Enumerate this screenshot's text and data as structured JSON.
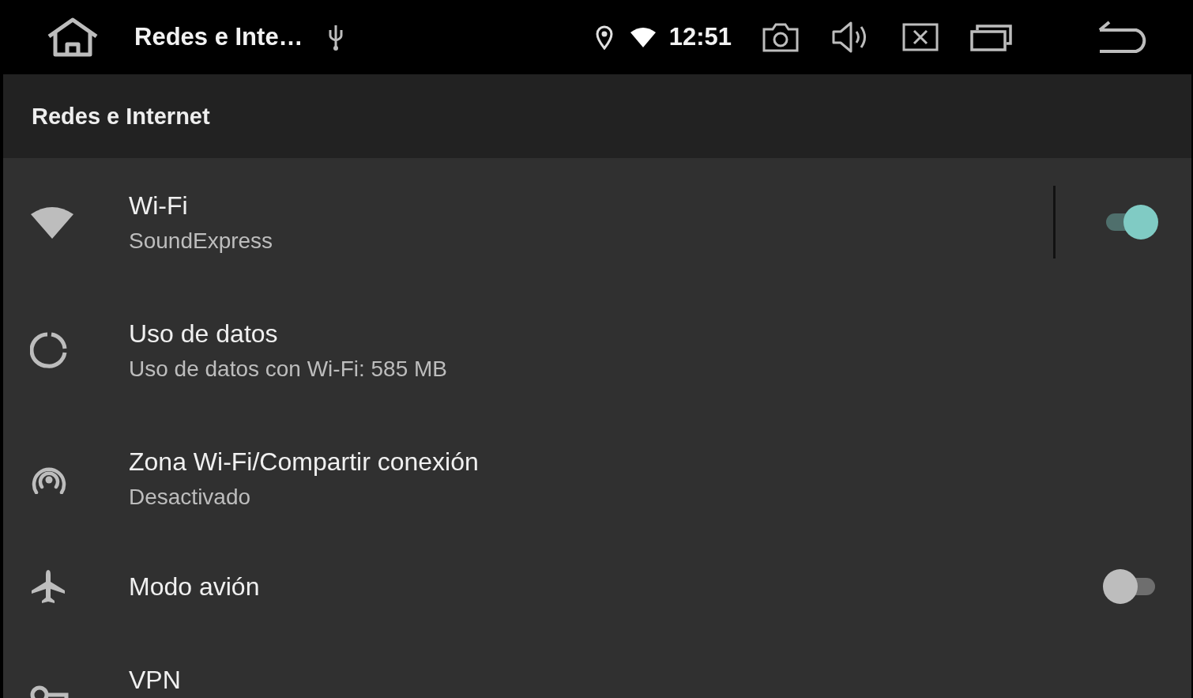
{
  "status_bar": {
    "title": "Redes e Inte…",
    "time": "12:51"
  },
  "header": {
    "title": "Redes e Internet"
  },
  "items": [
    {
      "kind": "toggle",
      "title": "Wi-Fi",
      "subtitle": "SoundExpress",
      "on": true
    },
    {
      "kind": "link",
      "title": "Uso de datos",
      "subtitle": "Uso de datos con Wi-Fi: 585 MB"
    },
    {
      "kind": "link",
      "title": "Zona Wi-Fi/Compartir conexión",
      "subtitle": "Desactivado"
    },
    {
      "kind": "toggle",
      "title": "Modo avión",
      "on": false
    },
    {
      "kind": "link",
      "title": "VPN"
    }
  ]
}
